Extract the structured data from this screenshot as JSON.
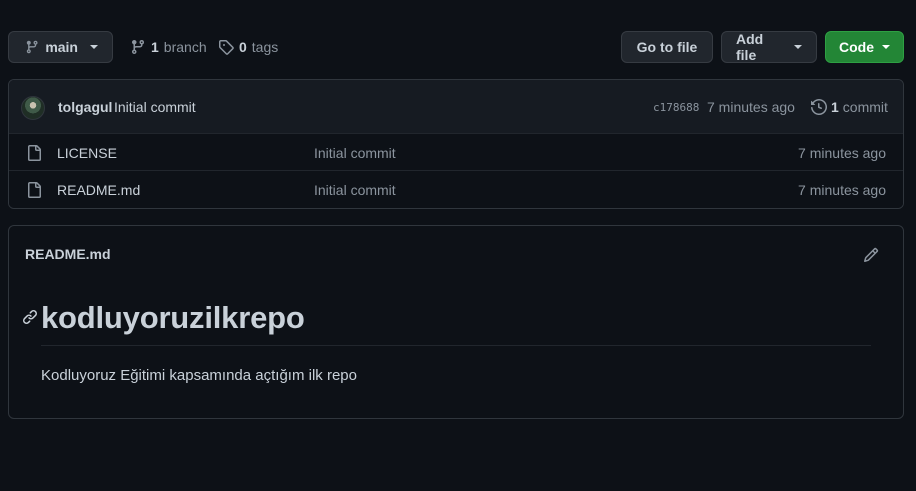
{
  "toolbar": {
    "branch_button_label": "main",
    "branch_count": "1",
    "branch_label": "branch",
    "tag_count": "0",
    "tag_label": "tags",
    "goto_file_label": "Go to file",
    "add_file_label": "Add file",
    "code_label": "Code"
  },
  "latest_commit": {
    "author": "tolgagul",
    "message": "Initial commit",
    "sha": "c178688",
    "time": "7 minutes ago",
    "count": "1",
    "count_label": "commit"
  },
  "files": [
    {
      "name": "LICENSE",
      "message": "Initial commit",
      "time": "7 minutes ago"
    },
    {
      "name": "README.md",
      "message": "Initial commit",
      "time": "7 minutes ago"
    }
  ],
  "readme": {
    "title": "README.md",
    "heading": "kodluyoruzilkrepo",
    "paragraph": "Kodluyoruz Eğitimi kapsamında açtığım ilk repo"
  },
  "colors": {
    "background": "#0d1117",
    "code_button": "#238636",
    "border": "#30363d"
  }
}
